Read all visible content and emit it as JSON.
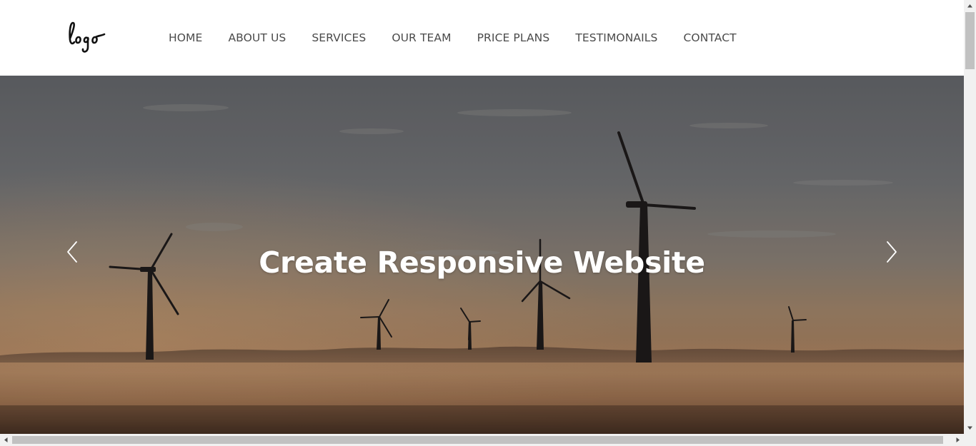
{
  "header": {
    "logo_text": "logo",
    "nav": [
      {
        "label": "HOME",
        "name": "nav-home"
      },
      {
        "label": "ABOUT US",
        "name": "nav-about-us"
      },
      {
        "label": "SERVICES",
        "name": "nav-services"
      },
      {
        "label": "OUR TEAM",
        "name": "nav-our-team"
      },
      {
        "label": "PRICE PLANS",
        "name": "nav-price-plans"
      },
      {
        "label": "TESTIMONAILS",
        "name": "nav-testimonails"
      },
      {
        "label": "CONTACT",
        "name": "nav-contact"
      }
    ]
  },
  "hero": {
    "title": "Create Responsive Website",
    "image": "wind-turbines-at-sunset",
    "prev_icon": "chevron-left-icon",
    "next_icon": "chevron-right-icon"
  },
  "colors": {
    "nav_text": "#4b4b4b",
    "hero_title": "#ffffff",
    "scrollbar_track": "#f1f1f1",
    "scrollbar_thumb": "#c1c1c1"
  }
}
